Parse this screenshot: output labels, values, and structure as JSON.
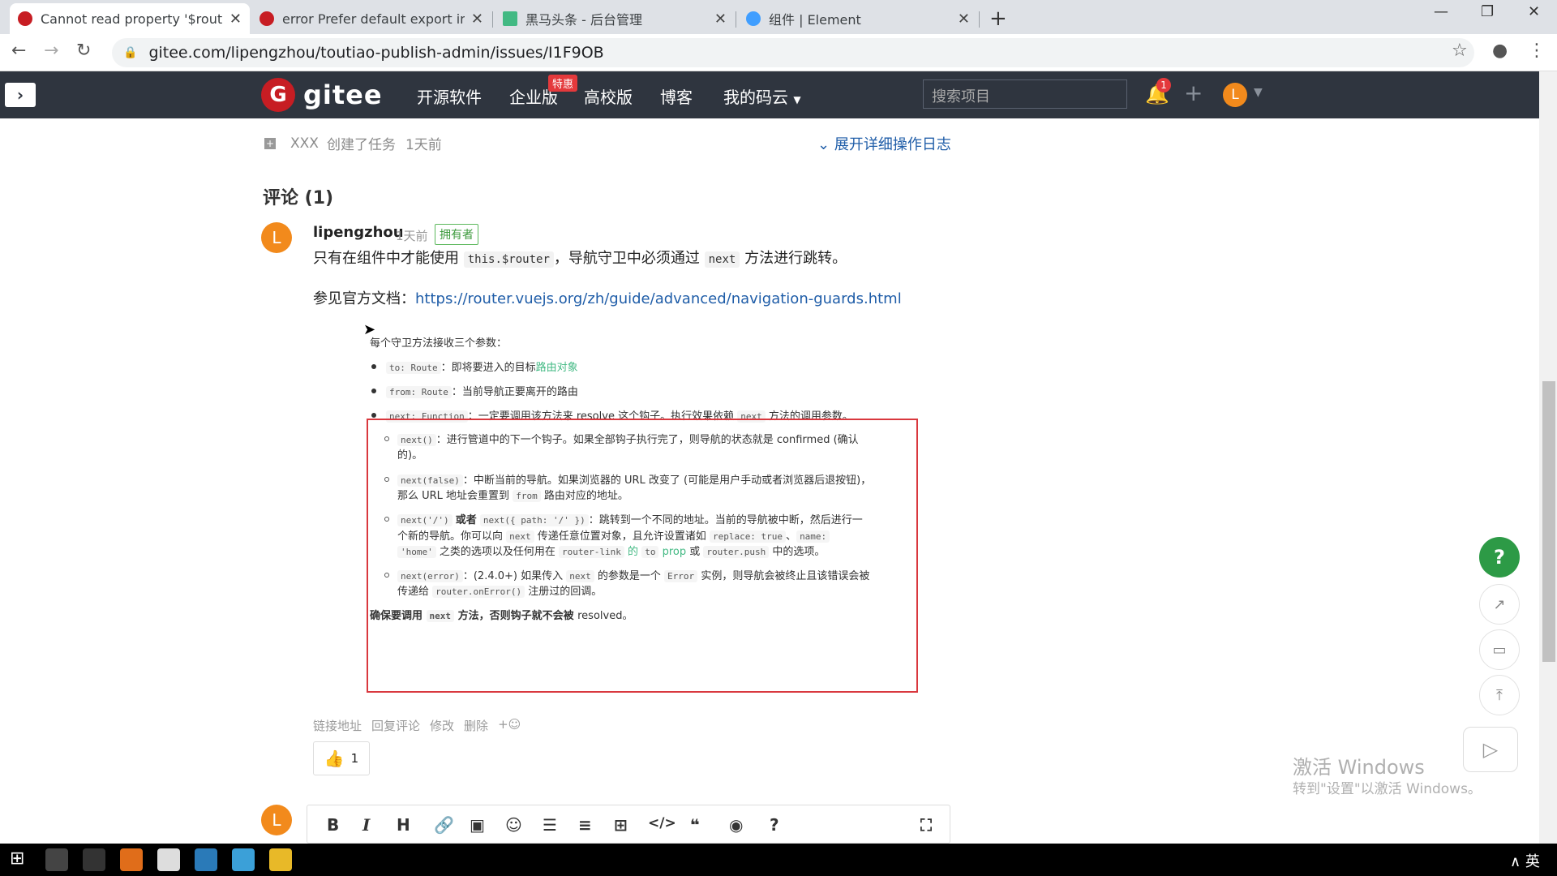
{
  "browser": {
    "tabs": [
      {
        "title": "Cannot read property '$router",
        "favicon_color": "#c71d23",
        "active": true
      },
      {
        "title": "error Prefer default export imp",
        "favicon_color": "#c71d23",
        "active": false
      },
      {
        "title": "黑马头条 - 后台管理",
        "favicon_color": "#42b983",
        "active": false
      },
      {
        "title": "组件 | Element",
        "favicon_color": "#409eff",
        "active": false
      }
    ],
    "url": "gitee.com/lipengzhou/toutiao-publish-admin/issues/I1F9OB"
  },
  "gitee": {
    "logo_text": "gitee",
    "nav": [
      "开源软件",
      "企业版",
      "高校版",
      "博客",
      "我的码云"
    ],
    "special_badge": "特惠",
    "search_placeholder": "搜索项目",
    "notification_count": "1",
    "user_initial": "L"
  },
  "issue": {
    "log_user": "XXX",
    "log_action": "创建了任务",
    "log_time": "1天前",
    "expand_log": "展开详细操作日志",
    "comments_title": "评论 (1)"
  },
  "comment": {
    "avatar": "L",
    "author": "lipengzhou",
    "time": "1天前",
    "badge": "拥有者",
    "body_pre": "只有在组件中才能使用",
    "body_code1": "this.$router",
    "body_mid": "，导航守卫中必须通过",
    "body_code2": "next",
    "body_post": "方法进行跳转。",
    "ref_label": "参见官方文档：",
    "ref_link": "https://router.vuejs.org/zh/guide/advanced/navigation-guards.html",
    "doc": {
      "intro": "每个守卫方法接收三个参数：",
      "to_code": "to: Route",
      "to_text": "：即将要进入的目标",
      "to_link": "路由对象",
      "from_code": "from: Route",
      "from_text": "：当前导航正要离开的路由",
      "next_code": "next: Function",
      "next_text": "：一定要调用该方法来 resolve 这个钩子。执行效果依赖",
      "next_code2": "next",
      "next_text2": "方法的调用参数。",
      "n1_code": "next()",
      "n1_text": "：进行管道中的下一个钩子。如果全部钩子执行完了，则导航的状态就是 confirmed (确认",
      "n1_text2": "的)。",
      "n2_code": "next(false)",
      "n2_text": "：中断当前的导航。如果浏览器的 URL 改变了 (可能是用户手动或者浏览器后退按钮)，",
      "n2_text2": "那么 URL 地址会重置到",
      "n2_code2": "from",
      "n2_text3": "路由对应的地址。",
      "n3_code": "next('/')",
      "n3_or": "或者",
      "n3_code2": "next({ path: '/' })",
      "n3_text": "：跳转到一个不同的地址。当前的导航被中断，然后进行一",
      "n3_line2a": "个新的导航。你可以向",
      "n3_code3": "next",
      "n3_line2b": "传递任意位置对象，且允许设置诸如",
      "n3_code4": "replace: true",
      "n3_sep": "、",
      "n3_code5": "name:",
      "n3_code6": "'home'",
      "n3_line3a": "之类的选项以及任何用在",
      "n3_code7": "router-link",
      "n3_line3b": "的",
      "n3_code8": "to",
      "n3_prop": "prop",
      "n3_line3c": "或",
      "n3_code9": "router.push",
      "n3_line3d": "中的选项。",
      "n4_code": "next(error)",
      "n4_text": "：(2.4.0+) 如果传入",
      "n4_code2": "next",
      "n4_text2": "的参数是一个",
      "n4_code3": "Error",
      "n4_text3": "实例，则导航会被终止且该错误会被",
      "n4_line2a": "传递给",
      "n4_code4": "router.onError()",
      "n4_line2b": "注册过的回调。",
      "ensure_a": "确保要调用",
      "ensure_code": "next",
      "ensure_b": "方法，否则钩子就不会被",
      "ensure_c": "resolved。"
    },
    "actions": [
      "链接地址",
      "回复评论",
      "修改",
      "删除",
      "+☺"
    ],
    "likes": "1"
  },
  "editor": {
    "avatar": "L",
    "tools": [
      "B",
      "I",
      "H",
      "🔗",
      "▣",
      "☺",
      "☰",
      "≡",
      "⊞",
      "</>",
      "❝",
      "◉",
      "?",
      "⛶"
    ]
  },
  "watermark": {
    "line1": "激活 Windows",
    "line2": "转到\"设置\"以激活 Windows。"
  },
  "taskbar": {
    "ime": "英"
  }
}
